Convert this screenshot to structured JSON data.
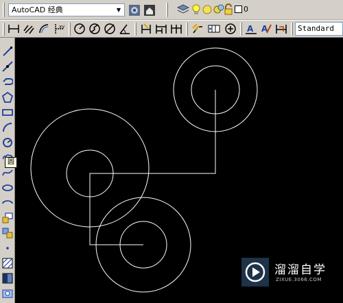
{
  "workspace": {
    "selected": "AutoCAD 经典"
  },
  "layer": {
    "current": "0"
  },
  "styles": {
    "text_style": "Standard"
  },
  "tooltip": {
    "text": "圆"
  },
  "watermark": {
    "title": "溜溜自学",
    "url": "ZIXUE.3066.COM"
  },
  "colors": {
    "canvas_bg": "#000000",
    "entity": "#ffffff",
    "toolbar_bg": "#d4d0c8"
  },
  "toolbars": {
    "standard_icons": [
      "layers-icon",
      "lightbulb-icon",
      "sun-icon",
      "freeze-icon",
      "lock-icon",
      "color-box-icon"
    ],
    "dimension_icons": [
      "linear-dimension-icon",
      "aligned-dimension-icon",
      "arc-length-icon",
      "ordinate-dimension-icon",
      "radius-dimension-icon",
      "jogged-dimension-icon",
      "diameter-dimension-icon",
      "angular-dimension-icon",
      "quick-dimension-icon",
      "baseline-dimension-icon",
      "continue-dimension-icon",
      "quick-leader-icon",
      "tolerance-icon",
      "center-mark-icon",
      "dimension-edit-icon",
      "dimension-text-edit-icon",
      "dimension-update-icon"
    ],
    "draw_icons": [
      "line-icon",
      "construction-line-icon",
      "polyline-icon",
      "polygon-icon",
      "rectangle-icon",
      "arc-icon",
      "circle-icon",
      "revision-cloud-icon",
      "spline-icon",
      "ellipse-icon",
      "ellipse-arc-icon",
      "insert-block-icon",
      "make-block-icon",
      "point-icon",
      "hatch-icon",
      "gradient-icon",
      "region-icon"
    ]
  }
}
